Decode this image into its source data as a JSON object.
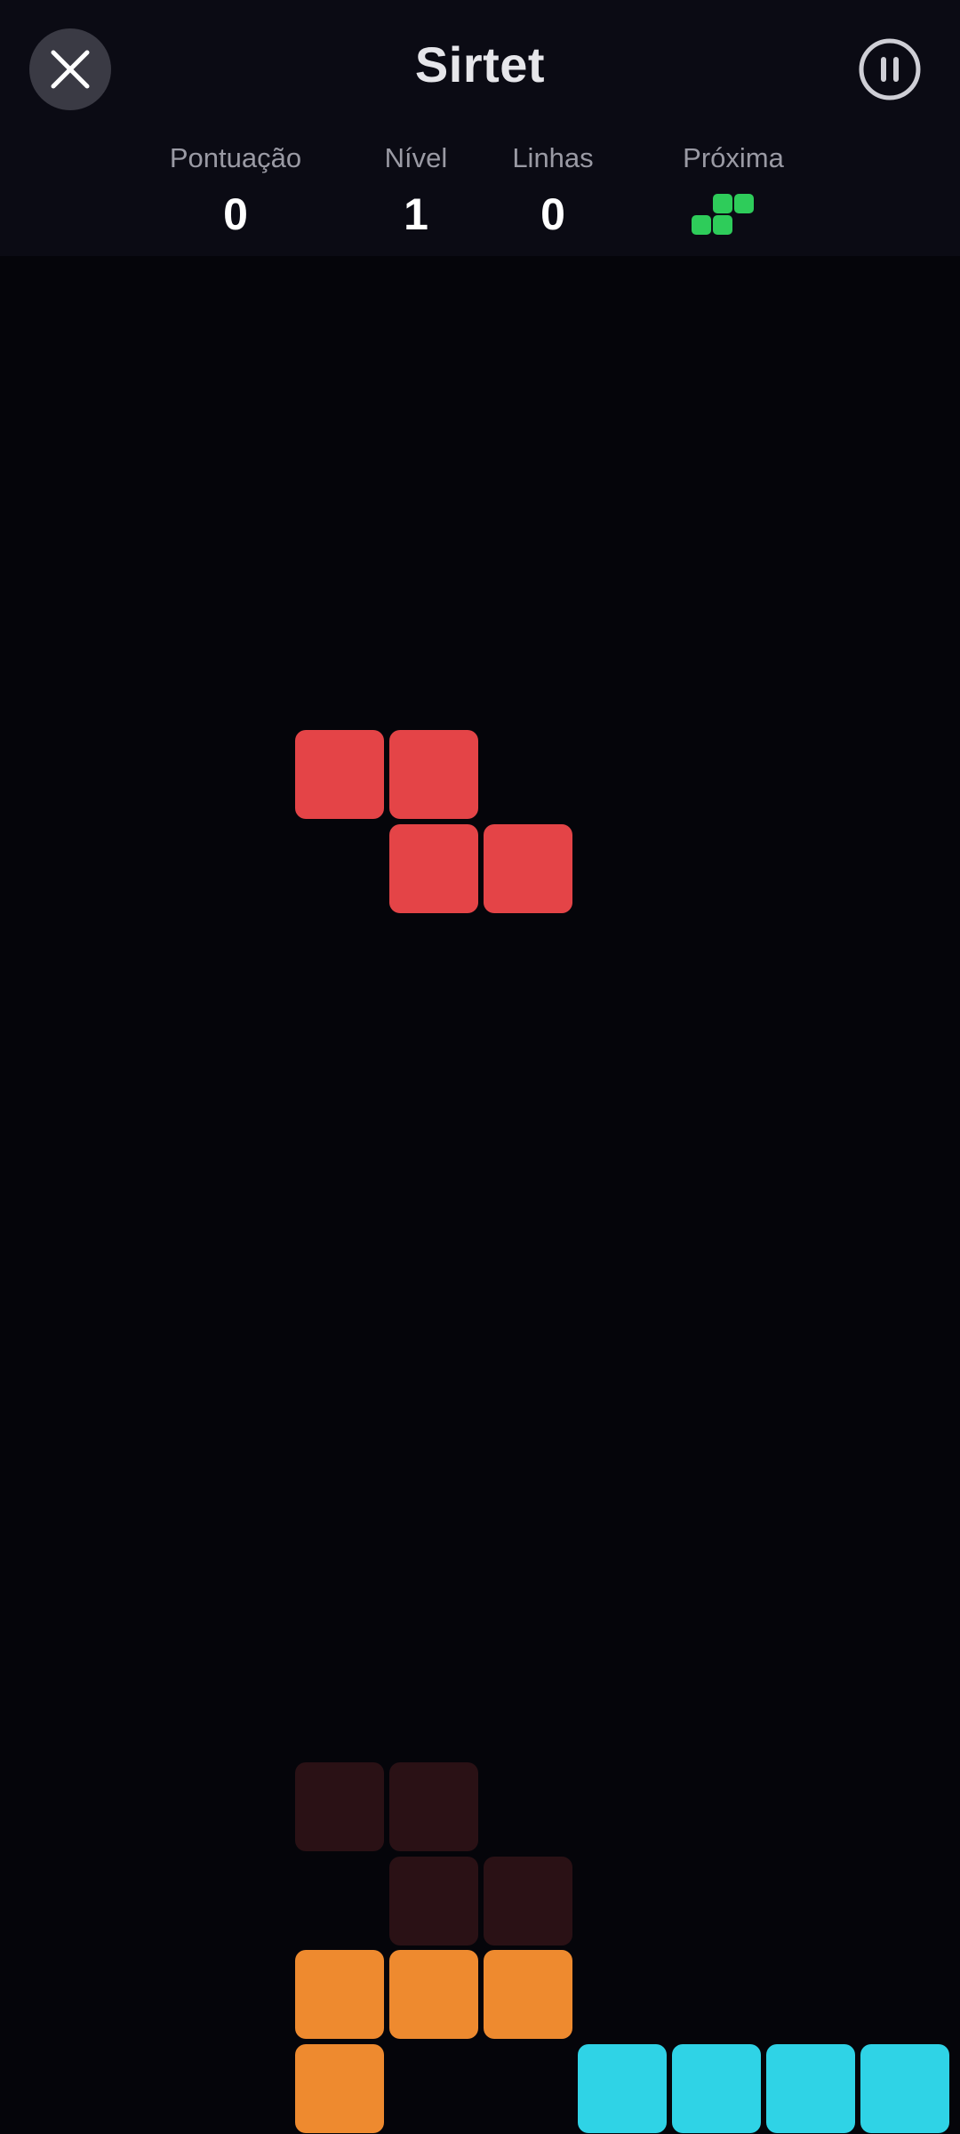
{
  "header": {
    "title": "Sirtet",
    "close_button": {
      "icon": "close-icon"
    },
    "pause_button": {
      "icon": "pause-icon"
    }
  },
  "stats": {
    "score": {
      "label": "Pontuação",
      "value": "0"
    },
    "level": {
      "label": "Nível",
      "value": "1"
    },
    "lines": {
      "label": "Linhas",
      "value": "0"
    },
    "next": {
      "label": "Próxima",
      "piece": "S",
      "color": "#2ecc5a"
    }
  },
  "board": {
    "columns": 10,
    "colors": {
      "active": "#e44447",
      "ghost": "#2a1115",
      "locked_orange": "#ee8a2f",
      "locked_cyan": "#2fd3e6",
      "background": "#05050a"
    },
    "active_piece": {
      "type": "Z",
      "cells": [
        [
          3,
          0
        ],
        [
          4,
          0
        ],
        [
          4,
          1
        ],
        [
          5,
          1
        ]
      ]
    },
    "ghost_piece": {
      "cells": [
        [
          3,
          0
        ],
        [
          4,
          0
        ],
        [
          4,
          1
        ],
        [
          5,
          1
        ]
      ]
    },
    "locked_cells": [
      {
        "col": 3,
        "row": 0,
        "color": "locked_orange"
      },
      {
        "col": 4,
        "row": 0,
        "color": "locked_orange"
      },
      {
        "col": 5,
        "row": 0,
        "color": "locked_orange"
      },
      {
        "col": 3,
        "row": 1,
        "color": "locked_orange"
      },
      {
        "col": 6,
        "row": 1,
        "color": "locked_cyan"
      },
      {
        "col": 7,
        "row": 1,
        "color": "locked_cyan"
      },
      {
        "col": 8,
        "row": 1,
        "color": "locked_cyan"
      },
      {
        "col": 9,
        "row": 1,
        "color": "locked_cyan"
      }
    ]
  }
}
